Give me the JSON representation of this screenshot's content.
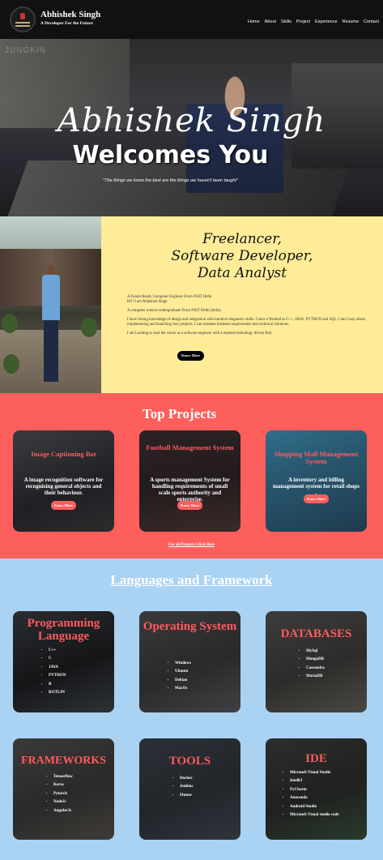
{
  "nav": {
    "brand": "Abhishek Singh",
    "tagline": "A Developer For the Future",
    "links": [
      "Home",
      "About",
      "Skills",
      "Project",
      "Experience",
      "Resume",
      "Contact"
    ]
  },
  "hero": {
    "watermark": "JUNGKIN",
    "title": "Abhishek Singh",
    "subtitle": "Welcomes You",
    "quote": "\"The things we know the best are the things we haven't been taught\""
  },
  "about": {
    "roles": [
      "Freelancer,",
      "Software Developer,",
      "Data Analyst"
    ],
    "paragraphs": [
      "A Future Ready Computer Engineer From NSIT Delhi",
      "Hi!! I am Abhishek Singh",
      "A computer science undergraduate From NSIT Delhi (India)",
      "I have Strong knowledge of design and integration with intuitive diagnostic skills. I have a Worked in C++, JAVA, PYTHON and SQL. I am Crazy about implementing and launching new projects. I can translate business requirements into technical solutions.",
      "I am Looking to start the career as a software engineer with a reputed technology driven firm."
    ],
    "button": "Know More"
  },
  "projects": {
    "heading": "Top Projects",
    "items": [
      {
        "title": "Image Captioning Bot",
        "desc": "A image recognition software for recognising general objects and their behaviour.",
        "button": "Know More"
      },
      {
        "title": "Football Management System",
        "desc": "A sports management System for handling requirements of small scale sports authority and enterprise.",
        "button": "Know More"
      },
      {
        "title": "Shopping Mall Management System",
        "desc": "A inventory and billing management system for retail shops .",
        "button": "Know More"
      }
    ],
    "all_link": "For all Projects Click Here"
  },
  "languages": {
    "heading": "Languages and Framework",
    "cards": [
      {
        "title": "Programming Language",
        "items": [
          "C++",
          "C",
          "JAVA",
          "PYTHON",
          "R",
          "KOTLIN"
        ]
      },
      {
        "title": "Operating System",
        "items": [
          "Windows",
          "Ubuntu",
          "Debian",
          "MacOs"
        ]
      },
      {
        "title": "DATABASES",
        "items": [
          "MySql",
          "MongoDB",
          "Cassandra",
          "MariaDB"
        ]
      },
      {
        "title": "FRAMEWORKS",
        "items": [
          "Tensorflow",
          "Keras",
          "Pytorch",
          "NodeJs",
          "AngularJs"
        ]
      },
      {
        "title": "TOOLS",
        "items": [
          "Docker",
          "Jenkins",
          "Flutter"
        ]
      },
      {
        "title": "IDE",
        "items": [
          "Microsoft Visual Studio",
          "IntelliJ",
          "PyCharm",
          "Anaconda",
          "Android Studio",
          "Microsoft Visual studio code"
        ]
      }
    ]
  }
}
